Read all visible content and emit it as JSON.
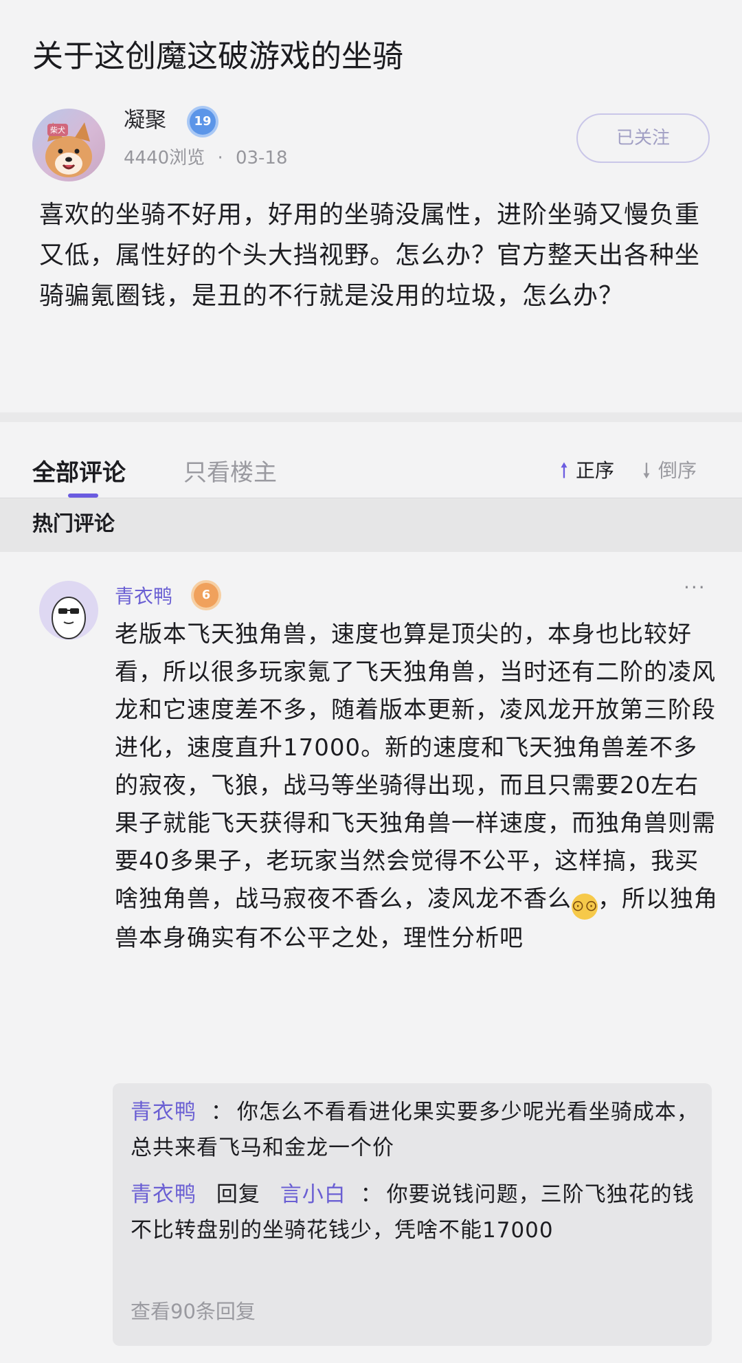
{
  "post": {
    "title": "关于这创魔这破游戏的坐骑",
    "author": "凝聚",
    "author_level": "19",
    "avatar_text": "柴犬",
    "views": "4440浏览",
    "separator": "·",
    "date": "03-18",
    "follow_label": "已关注",
    "body": "喜欢的坐骑不好用，好用的坐骑没属性，进阶坐骑又慢负重又低，属性好的个头大挡视野。怎么办？官方整天出各种坐骑骗氪圈钱，是丑的不行就是没用的垃圾，怎么办？"
  },
  "tabs": {
    "all": "全部评论",
    "op_only": "只看楼主",
    "sort_asc": "正序",
    "sort_desc": "倒序"
  },
  "hot_section": {
    "label": "热门评论"
  },
  "comment": {
    "author": "青衣鸭",
    "level": "6",
    "more": "···",
    "body_part1": "老版本飞天独角兽，速度也算是顶尖的，本身也比较好看，所以很多玩家氪了飞天独角兽，当时还有二阶的凌风龙和它速度差不多，随着版本更新，凌风龙开放第三阶段进化，速度直升17000。新的速度和飞天独角兽差不多的寂夜，飞狼，战马等坐骑得出现，而且只需要20左右果子就能飞天获得和飞天独角兽一样速度，而独角兽则需要40多果子，老玩家当然会觉得不公平，这样搞，我买啥独角兽，战马寂夜不香么，凌风龙不香么",
    "body_part2": "，所以独角兽本身确实有不公平之处，理性分析吧",
    "emoji": "flushed-face-emoji",
    "replies": [
      {
        "author": "青衣鸭",
        "reply_word": "",
        "target": "",
        "colon": "：",
        "text": "你怎么不看看进化果实要多少呢光看坐骑成本，总共来看飞马和金龙一个价"
      },
      {
        "author": "青衣鸭",
        "reply_word": "回复",
        "target": "言小白",
        "colon": "：",
        "text": "你要说钱问题，三阶飞独花的钱不比转盘别的坐骑花钱少，凭啥不能17000"
      }
    ],
    "view_more": "查看90条回复"
  },
  "colors": {
    "accent": "#6b5ce0",
    "username": "#6a5fd3",
    "muted": "#9a9aa0",
    "background": "#f3f3f4"
  }
}
